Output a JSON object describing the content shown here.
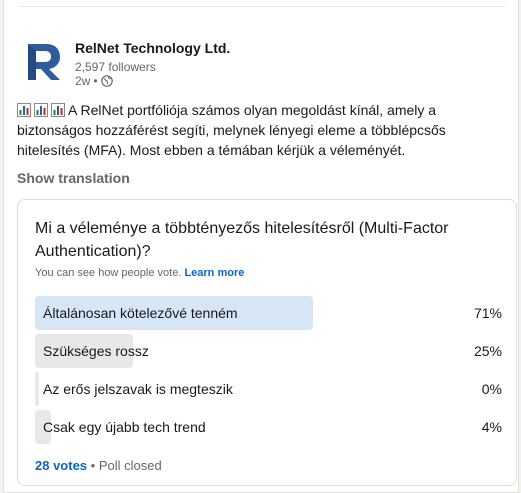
{
  "post": {
    "company_name": "RelNet Technology Ltd.",
    "followers": "2,597 followers",
    "time": "2w",
    "time_separator": "•",
    "body": "A RelNet portfóliója számos olyan megoldást kínál, amely a biztonságos hozzáférést segíti, melynek lényegi eleme a többlépcsős hitelesítés (MFA). Most ebben a témában kérjük a véleményét.",
    "show_translation": "Show translation"
  },
  "poll": {
    "question": "Mi a véleménye a többtényezős hitelesítésről (Multi-Factor Authentication)?",
    "visibility_text": "You can see how people vote.",
    "learn_more": "Learn more",
    "options": [
      {
        "label": "Általánosan kötelezővé tenném",
        "percent_text": "71%",
        "percent": 71,
        "selected": true
      },
      {
        "label": "Szükséges rossz",
        "percent_text": "25%",
        "percent": 25,
        "selected": false
      },
      {
        "label": "Az erős jelszavak is megteszik",
        "percent_text": "0%",
        "percent": 0,
        "selected": false
      },
      {
        "label": "Csak egy újabb tech trend",
        "percent_text": "4%",
        "percent": 4,
        "selected": false
      }
    ],
    "votes": "28 votes",
    "separator": "•",
    "status": "Poll closed"
  },
  "colors": {
    "brand_logo": "#2f5c9a",
    "link": "#0a66c2",
    "bar_selected": "#d6e6f7",
    "bar_default": "#e8e8e8"
  },
  "icons": {
    "logo": "relnet-logo",
    "visibility": "globe-icon",
    "post_emoji": "bar-chart-emoji"
  }
}
